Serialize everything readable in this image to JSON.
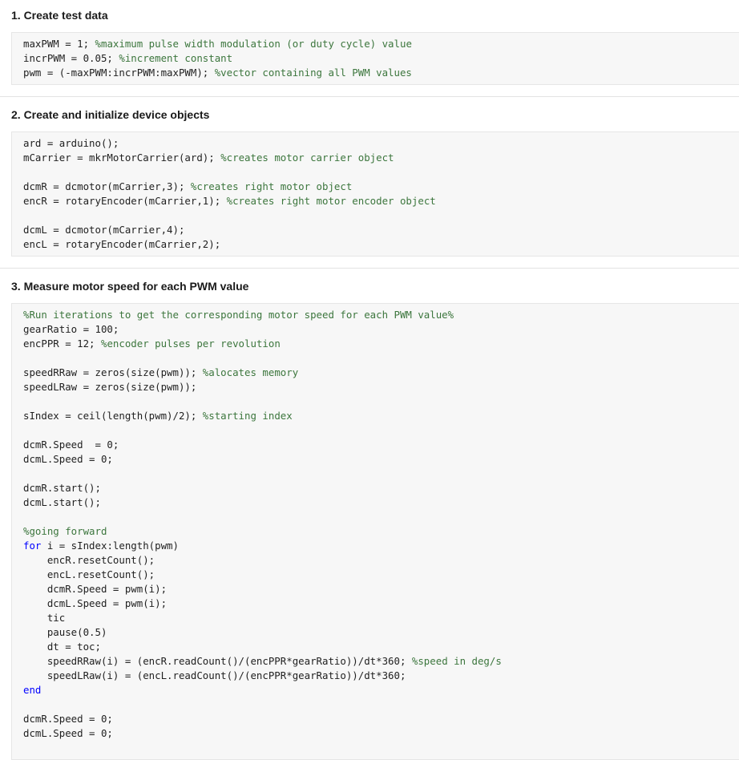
{
  "sections": [
    {
      "title": "1. Create test data",
      "lines": [
        [
          [
            "code",
            "maxPWM = 1; "
          ],
          [
            "cm",
            "%maximum pulse width modulation (or duty cycle) value"
          ]
        ],
        [
          [
            "code",
            "incrPWM = 0.05; "
          ],
          [
            "cm",
            "%increment constant"
          ]
        ],
        [
          [
            "code",
            "pwm = (-maxPWM:incrPWM:maxPWM); "
          ],
          [
            "cm",
            "%vector containing all PWM values"
          ]
        ]
      ]
    },
    {
      "title": "2. Create and initialize device objects",
      "lines": [
        [
          [
            "code",
            "ard = arduino();"
          ]
        ],
        [
          [
            "code",
            "mCarrier = mkrMotorCarrier(ard); "
          ],
          [
            "cm",
            "%creates motor carrier object"
          ]
        ],
        [],
        [
          [
            "code",
            "dcmR = dcmotor(mCarrier,3); "
          ],
          [
            "cm",
            "%creates right motor object"
          ]
        ],
        [
          [
            "code",
            "encR = rotaryEncoder(mCarrier,1); "
          ],
          [
            "cm",
            "%creates right motor encoder object"
          ]
        ],
        [],
        [
          [
            "code",
            "dcmL = dcmotor(mCarrier,4);"
          ]
        ],
        [
          [
            "code",
            "encL = rotaryEncoder(mCarrier,2);"
          ]
        ]
      ]
    },
    {
      "title": "3. Measure motor speed for each PWM value",
      "lines": [
        [
          [
            "cm",
            "%Run iterations to get the corresponding motor speed for each PWM value%"
          ]
        ],
        [
          [
            "code",
            "gearRatio = 100;"
          ]
        ],
        [
          [
            "code",
            "encPPR = 12; "
          ],
          [
            "cm",
            "%encoder pulses per revolution"
          ]
        ],
        [],
        [
          [
            "code",
            "speedRRaw = zeros(size(pwm)); "
          ],
          [
            "cm",
            "%alocates memory"
          ]
        ],
        [
          [
            "code",
            "speedLRaw = zeros(size(pwm));"
          ]
        ],
        [],
        [
          [
            "code",
            "sIndex = ceil(length(pwm)/2); "
          ],
          [
            "cm",
            "%starting index"
          ]
        ],
        [],
        [
          [
            "code",
            "dcmR.Speed  = 0;"
          ]
        ],
        [
          [
            "code",
            "dcmL.Speed = 0;"
          ]
        ],
        [],
        [
          [
            "code",
            "dcmR.start();"
          ]
        ],
        [
          [
            "code",
            "dcmL.start();"
          ]
        ],
        [],
        [
          [
            "cm",
            "%going forward"
          ]
        ],
        [
          [
            "kw",
            "for "
          ],
          [
            "code",
            "i = sIndex:length(pwm)"
          ]
        ],
        [
          [
            "code",
            "    encR.resetCount();"
          ]
        ],
        [
          [
            "code",
            "    encL.resetCount();"
          ]
        ],
        [
          [
            "code",
            "    dcmR.Speed = pwm(i);"
          ]
        ],
        [
          [
            "code",
            "    dcmL.Speed = pwm(i);"
          ]
        ],
        [
          [
            "code",
            "    tic"
          ]
        ],
        [
          [
            "code",
            "    pause(0.5)"
          ]
        ],
        [
          [
            "code",
            "    dt = toc;"
          ]
        ],
        [
          [
            "code",
            "    speedRRaw(i) = (encR.readCount()/(encPPR*gearRatio))/dt*360; "
          ],
          [
            "cm",
            "%speed in deg/s"
          ]
        ],
        [
          [
            "code",
            "    speedLRaw(i) = (encL.readCount()/(encPPR*gearRatio))/dt*360;"
          ]
        ],
        [
          [
            "kw",
            "end"
          ]
        ],
        [],
        [
          [
            "code",
            "dcmR.Speed = 0;"
          ]
        ],
        [
          [
            "code",
            "dcmL.Speed = 0;"
          ]
        ]
      ]
    }
  ]
}
